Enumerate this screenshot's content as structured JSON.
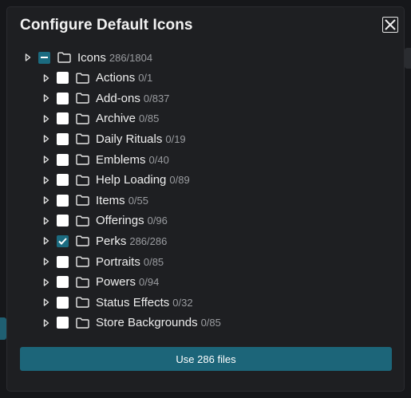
{
  "dialog": {
    "title": "Configure Default Icons",
    "use_button_label": "Use 286 files"
  },
  "root": {
    "label": "Icons",
    "count": "286/1804",
    "state": "partial"
  },
  "folders": [
    {
      "label": "Actions",
      "count": "0/1",
      "checked": false
    },
    {
      "label": "Add-ons",
      "count": "0/837",
      "checked": false
    },
    {
      "label": "Archive",
      "count": "0/85",
      "checked": false
    },
    {
      "label": "Daily Rituals",
      "count": "0/19",
      "checked": false
    },
    {
      "label": "Emblems",
      "count": "0/40",
      "checked": false
    },
    {
      "label": "Help Loading",
      "count": "0/89",
      "checked": false
    },
    {
      "label": "Items",
      "count": "0/55",
      "checked": false
    },
    {
      "label": "Offerings",
      "count": "0/96",
      "checked": false
    },
    {
      "label": "Perks",
      "count": "286/286",
      "checked": true
    },
    {
      "label": "Portraits",
      "count": "0/85",
      "checked": false
    },
    {
      "label": "Powers",
      "count": "0/94",
      "checked": false
    },
    {
      "label": "Status Effects",
      "count": "0/32",
      "checked": false
    },
    {
      "label": "Store Backgrounds",
      "count": "0/85",
      "checked": false
    }
  ],
  "colors": {
    "accent": "#1c6579",
    "checked": "#1b6b80"
  },
  "icons": {
    "close": "close-icon",
    "folder": "folder-icon",
    "expand": "caret-right-icon"
  }
}
